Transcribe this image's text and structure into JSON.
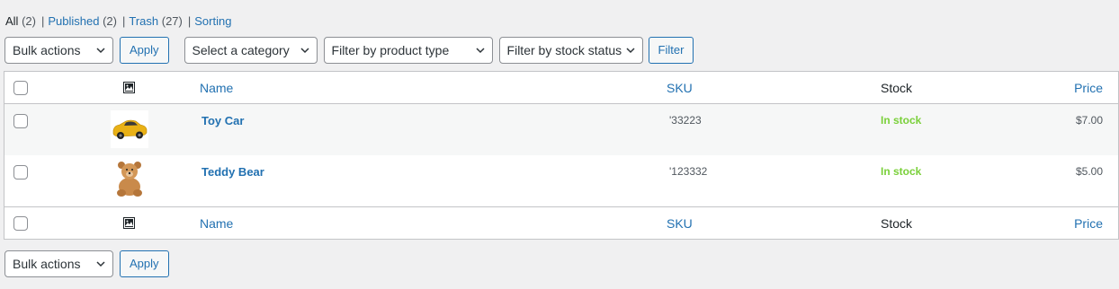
{
  "status_links": [
    {
      "label": "All",
      "count": "(2)",
      "current": true
    },
    {
      "label": "Published",
      "count": "(2)"
    },
    {
      "label": "Trash",
      "count": "(27)"
    },
    {
      "label": "Sorting",
      "count": ""
    }
  ],
  "separator": "|",
  "top_toolbar": {
    "bulk_actions": "Bulk actions",
    "apply": "Apply",
    "category": "Select a category",
    "product_type": "Filter by product type",
    "stock_status": "Filter by stock status",
    "filter": "Filter"
  },
  "bottom_toolbar": {
    "bulk_actions": "Bulk actions",
    "apply": "Apply"
  },
  "columns": {
    "image": "image-icon",
    "name": "Name",
    "sku": "SKU",
    "stock": "Stock",
    "price": "Price"
  },
  "products": [
    {
      "name": "Toy Car",
      "sku": "'33223",
      "stock": "In stock",
      "price": "$7.00",
      "thumbnail": "toy-car"
    },
    {
      "name": "Teddy Bear",
      "sku": "'123332",
      "stock": "In stock",
      "price": "$5.00",
      "thumbnail": "teddy-bear"
    }
  ],
  "colors": {
    "link": "#2271b1",
    "in_stock": "#7ad03a",
    "background": "#f0f0f1",
    "border": "#c3c4c7"
  }
}
